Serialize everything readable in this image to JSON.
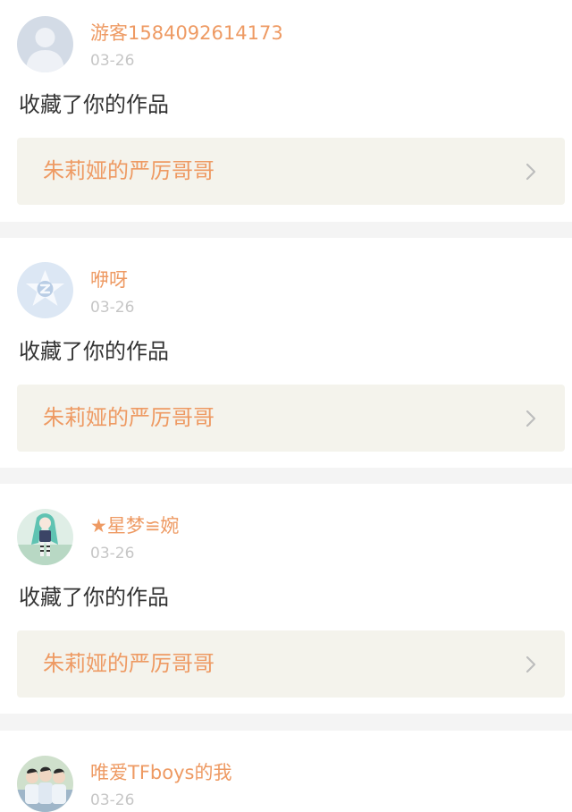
{
  "feed": {
    "items": [
      {
        "avatar_icon": "default-user-avatar-icon",
        "username": "游客1584092614173",
        "time": "03-26",
        "action": "收藏了你的作品",
        "work_title": "朱莉娅的严厉哥哥"
      },
      {
        "avatar_icon": "qq-logo-avatar-icon",
        "username": "咿呀",
        "time": "03-26",
        "action": "收藏了你的作品",
        "work_title": "朱莉娅的严厉哥哥"
      },
      {
        "avatar_icon": "anime-character-avatar-icon",
        "username": "★星梦≌婉",
        "time": "03-26",
        "action": "收藏了你的作品",
        "work_title": "朱莉娅的严厉哥哥"
      },
      {
        "avatar_icon": "group-photo-avatar-icon",
        "username": "唯爱TFboys的我",
        "time": "03-26"
      }
    ]
  },
  "colors": {
    "accent": "#ee9a63",
    "timestamp": "#c6c6c6",
    "work_card_bg": "#f4f3ec",
    "separator": "#f4f4f4",
    "text": "#333333"
  }
}
